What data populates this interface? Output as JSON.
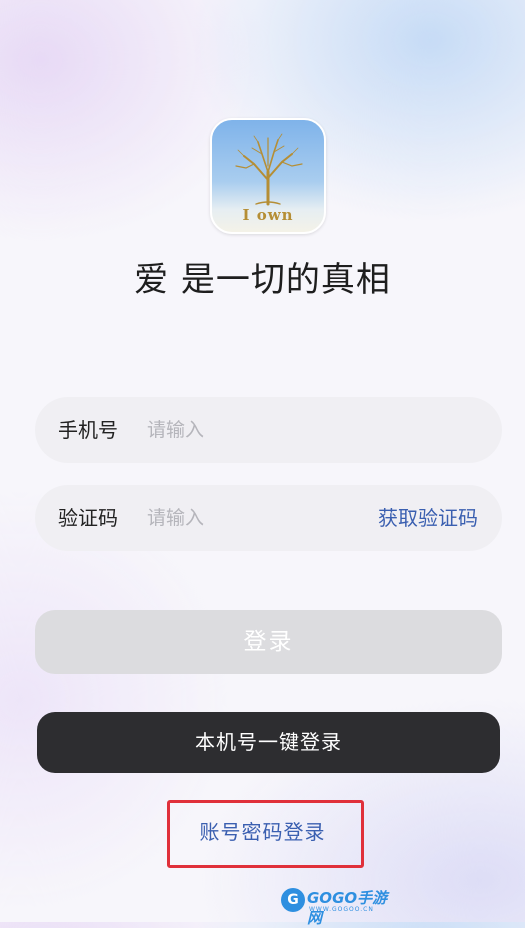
{
  "app": {
    "icon_text": "I own",
    "icon_name": "tree-logo-icon",
    "slogan": "爱 是一切的真相"
  },
  "phone_field": {
    "label": "手机号",
    "placeholder": "请输入",
    "value": ""
  },
  "code_field": {
    "label": "验证码",
    "placeholder": "请输入",
    "value": "",
    "get_code_label": "获取验证码"
  },
  "buttons": {
    "login_label": "登录",
    "onekey_login_label": "本机号一键登录",
    "password_login_label": "账号密码登录"
  },
  "watermark": {
    "logo_char": "G",
    "text": "GOGO手游网",
    "sub": "WWW.GOGOO.CN"
  },
  "colors": {
    "link": "#3a5fb0",
    "login_disabled_bg": "#dcdcdf",
    "onekey_bg": "#2d2d30",
    "highlight_box": "#e0303a"
  }
}
